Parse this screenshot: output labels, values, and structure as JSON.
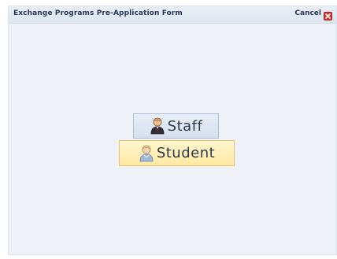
{
  "window": {
    "title": "Exchange Programs Pre-Application Form",
    "cancel_label": "Cancel"
  },
  "choices": [
    {
      "label": "Staff",
      "icon": "staff-person-icon",
      "state": "normal"
    },
    {
      "label": "Student",
      "icon": "student-person-icon",
      "state": "highlighted"
    }
  ],
  "colors": {
    "panel_background": "#eef2f8",
    "staff_button": "#dfe6f1",
    "student_button_highlight": "#ffeeb0",
    "cancel_icon": "#d9342b"
  }
}
